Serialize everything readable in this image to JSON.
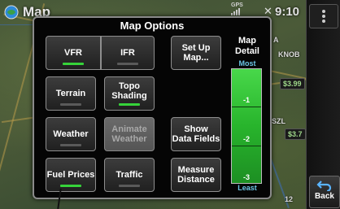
{
  "status": {
    "app_title": "Map",
    "gps_label": "GPS",
    "time": "9:10",
    "back_label": "Back"
  },
  "dialog": {
    "title": "Map Options",
    "buttons": {
      "vfr": {
        "label": "VFR",
        "indicator_on": true
      },
      "ifr": {
        "label": "IFR",
        "indicator_on": false
      },
      "terrain": {
        "label": "Terrain",
        "indicator_on": false
      },
      "topo_shading": {
        "label_line1": "Topo",
        "label_line2": "Shading",
        "indicator_on": true
      },
      "weather": {
        "label": "Weather",
        "indicator_on": false
      },
      "animate_weather": {
        "label_line1": "Animate",
        "label_line2": "Weather",
        "enabled": false
      },
      "fuel_prices": {
        "label": "Fuel Prices",
        "indicator_on": true
      },
      "traffic": {
        "label": "Traffic",
        "indicator_on": false
      },
      "set_up_map": {
        "label_line1": "Set Up",
        "label_line2": "Map..."
      },
      "show_data_fields": {
        "label_line1": "Show",
        "label_line2": "Data Fields"
      },
      "measure_distance": {
        "label_line1": "Measure",
        "label_line2": "Distance"
      }
    },
    "map_detail": {
      "label_line1": "Map",
      "label_line2": "Detail",
      "most_label": "Most",
      "least_label": "Least",
      "levels": [
        "-1",
        "-2",
        "-3"
      ],
      "current_level": "Most"
    }
  },
  "map_labels": {
    "price_1": "$3.99",
    "price_2": "$3.7",
    "airport_1": "SZL",
    "town_1": "KNOB",
    "town_2": "A",
    "freq_1": "12"
  },
  "colors": {
    "indicator_on": "#36d33a",
    "indicator_off": "#5a5a5a",
    "detail_bar": "#2fbf33",
    "detail_text": "#6cc6e6"
  }
}
